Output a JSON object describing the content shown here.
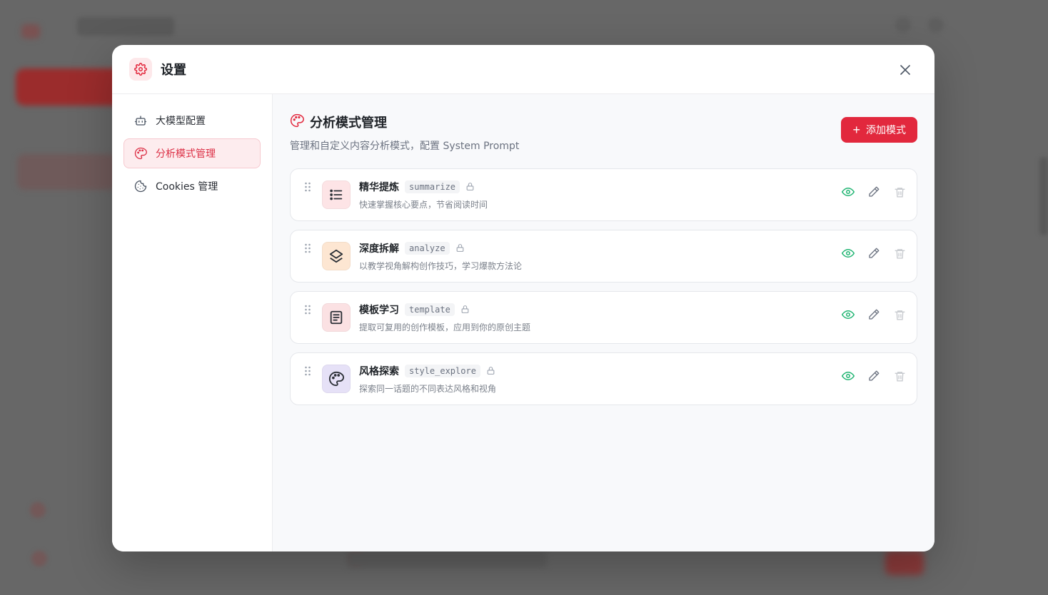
{
  "modal": {
    "title": "设置",
    "accent_color": "#e2283d"
  },
  "sidebar": {
    "items": [
      {
        "label": "大模型配置",
        "icon": "bot-icon",
        "active": false
      },
      {
        "label": "分析模式管理",
        "icon": "palette-icon",
        "active": true
      },
      {
        "label": "Cookies 管理",
        "icon": "cookie-icon",
        "active": false
      }
    ]
  },
  "content": {
    "title": "分析模式管理",
    "description": "管理和自定义内容分析模式，配置 System Prompt",
    "add_button_label": "添加模式"
  },
  "modes": [
    {
      "name": "精华提炼",
      "key": "summarize",
      "description": "快速掌握核心要点，节省阅读时间",
      "icon": "list-icon",
      "icon_bg": "#fde4e6",
      "icon_color": "#2b2f36"
    },
    {
      "name": "深度拆解",
      "key": "analyze",
      "description": "以教学视角解构创作技巧，学习爆款方法论",
      "icon": "layers-icon",
      "icon_bg": "#fde6d2",
      "icon_color": "#2b2f36"
    },
    {
      "name": "模板学习",
      "key": "template",
      "description": "提取可复用的创作模板，应用到你的原创主题",
      "icon": "document-icon",
      "icon_bg": "#fbe1e3",
      "icon_color": "#2b2f36"
    },
    {
      "name": "风格探索",
      "key": "style_explore",
      "description": "探索同一话题的不同表达风格和视角",
      "icon": "palette-icon",
      "icon_bg": "#e6e1f7",
      "icon_color": "#2b2f36"
    }
  ],
  "colors": {
    "view_icon": "#22b573",
    "edit_icon": "#6b7280",
    "delete_icon": "#c4c7cc"
  }
}
